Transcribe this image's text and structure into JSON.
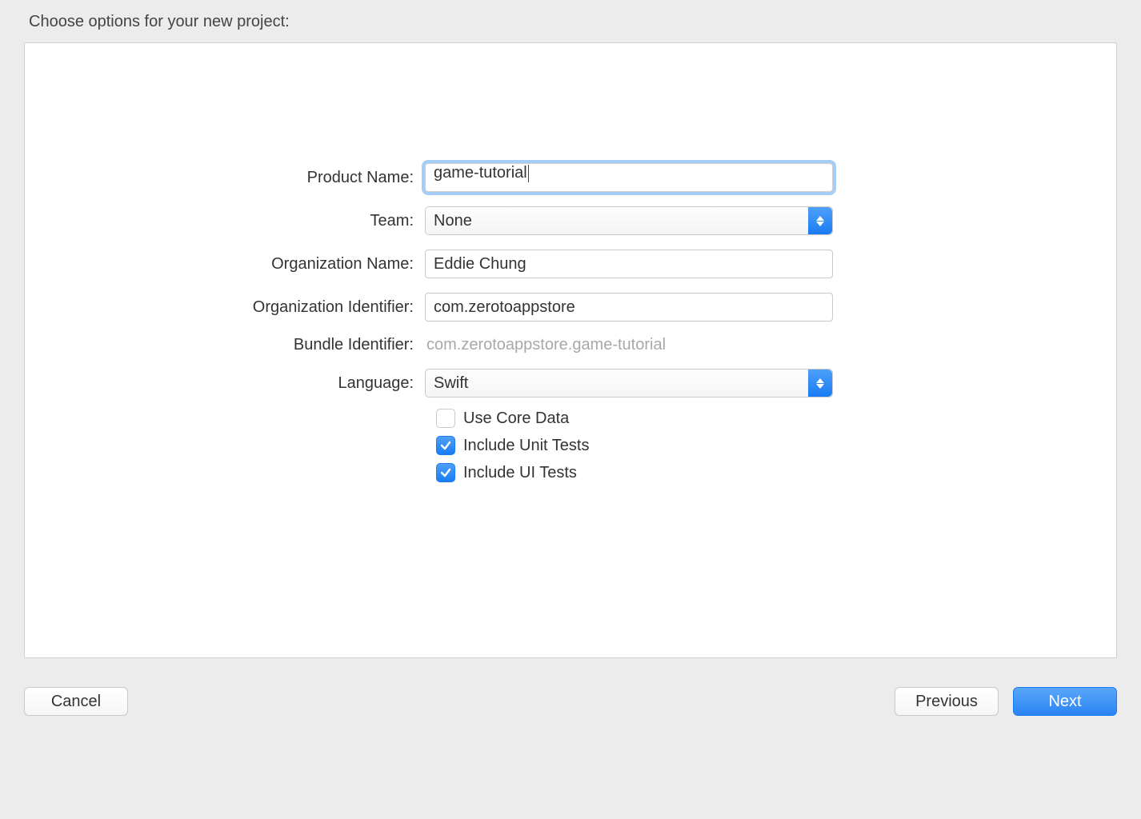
{
  "header": "Choose options for your new project:",
  "form": {
    "product_name_label": "Product Name:",
    "product_name_value": "game-tutorial",
    "team_label": "Team:",
    "team_value": "None",
    "org_name_label": "Organization Name:",
    "org_name_value": "Eddie Chung",
    "org_id_label": "Organization Identifier:",
    "org_id_value": "com.zerotoappstore",
    "bundle_id_label": "Bundle Identifier:",
    "bundle_id_value": "com.zerotoappstore.game-tutorial",
    "language_label": "Language:",
    "language_value": "Swift",
    "use_core_data_label": "Use Core Data",
    "use_core_data_checked": false,
    "include_unit_tests_label": "Include Unit Tests",
    "include_unit_tests_checked": true,
    "include_ui_tests_label": "Include UI Tests",
    "include_ui_tests_checked": true
  },
  "buttons": {
    "cancel": "Cancel",
    "previous": "Previous",
    "next": "Next"
  },
  "colors": {
    "accent": "#2a84f5",
    "focus_ring": "#a6cdf6",
    "panel_bg": "#ffffff",
    "page_bg": "#ececec"
  }
}
